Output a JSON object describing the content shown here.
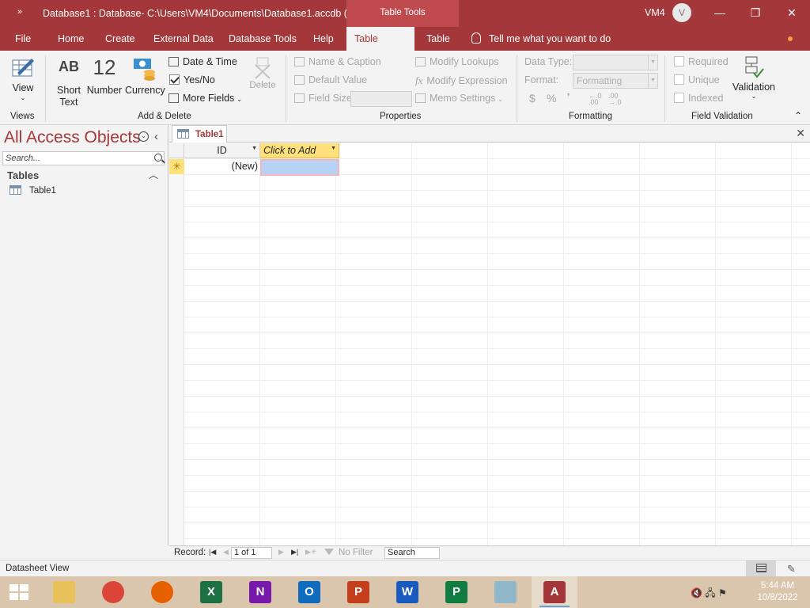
{
  "titlebar": {
    "qat": "»",
    "title": "Database1 : Database- C:\\Users\\VM4\\Documents\\Database1.accdb (...",
    "context_tab": "Table Tools",
    "user": "VM4",
    "avatar": "V",
    "minimize": "—",
    "restore": "❐",
    "close": "✕"
  },
  "tabs": {
    "file": "File",
    "home": "Home",
    "create": "Create",
    "external": "External Data",
    "dbtools": "Database Tools",
    "help": "Help",
    "table_fields": "Table Fields",
    "table": "Table",
    "tell_me": "Tell me what you want to do"
  },
  "ribbon": {
    "views": {
      "label": "Views",
      "view_button": "View",
      "view_icon": "datasheet-view-icon"
    },
    "add_delete": {
      "label": "Add & Delete",
      "short_text_icon": "AB",
      "short_text": "Short",
      "short_text_2": "Text",
      "number_icon": "12",
      "number": "Number",
      "currency": "Currency",
      "date_time": "Date & Time",
      "yes_no": "Yes/No",
      "more_fields": "More Fields",
      "delete": "Delete"
    },
    "properties": {
      "label": "Properties",
      "name_caption": "Name & Caption",
      "default_value": "Default Value",
      "field_size": "Field Size",
      "modify_lookups": "Modify Lookups",
      "modify_expression": "Modify Expression",
      "memo_settings": "Memo Settings"
    },
    "formatting": {
      "label": "Formatting",
      "data_type": "Data Type:",
      "format": "Format:",
      "format_value": "Formatting",
      "currency_sym": "$",
      "percent_sym": "%",
      "comma_sym": "❜",
      "inc_decimals": "←.0 .00",
      "dec_decimals": ".00 →.0"
    },
    "validation": {
      "label": "Field Validation",
      "required": "Required",
      "unique": "Unique",
      "indexed": "Indexed",
      "validation": "Validation"
    }
  },
  "nav": {
    "title": "All Access Objects",
    "search_placeholder": "Search...",
    "section": "Tables",
    "items": [
      {
        "label": "Table1"
      }
    ]
  },
  "document": {
    "tab_label": "Table1",
    "columns": [
      "ID",
      "Click to Add"
    ],
    "new_row_marker": "✳",
    "new_row_id": "(New)"
  },
  "record_nav": {
    "label": "Record:",
    "position": "1 of 1",
    "filter": "No Filter",
    "search": "Search"
  },
  "status": {
    "text": "Datasheet View"
  },
  "taskbar": {
    "apps": [
      {
        "name": "file-explorer",
        "glyph": "",
        "color": "#e8c15a"
      },
      {
        "name": "chrome",
        "glyph": "",
        "color": "#db4437"
      },
      {
        "name": "firefox",
        "glyph": "",
        "color": "#e66000"
      },
      {
        "name": "excel",
        "glyph": "X",
        "color": "#1d7044"
      },
      {
        "name": "onenote",
        "glyph": "N",
        "color": "#7719aa"
      },
      {
        "name": "outlook",
        "glyph": "O",
        "color": "#0f6cbd"
      },
      {
        "name": "powerpoint",
        "glyph": "P",
        "color": "#c43e1c"
      },
      {
        "name": "word",
        "glyph": "W",
        "color": "#185abd"
      },
      {
        "name": "project",
        "glyph": "P",
        "color": "#107c41"
      },
      {
        "name": "notepad",
        "glyph": "",
        "color": "#8fb7c9"
      },
      {
        "name": "access",
        "glyph": "A",
        "color": "#a4373a"
      }
    ],
    "time": "5:44 AM",
    "date": "10/8/2022"
  }
}
